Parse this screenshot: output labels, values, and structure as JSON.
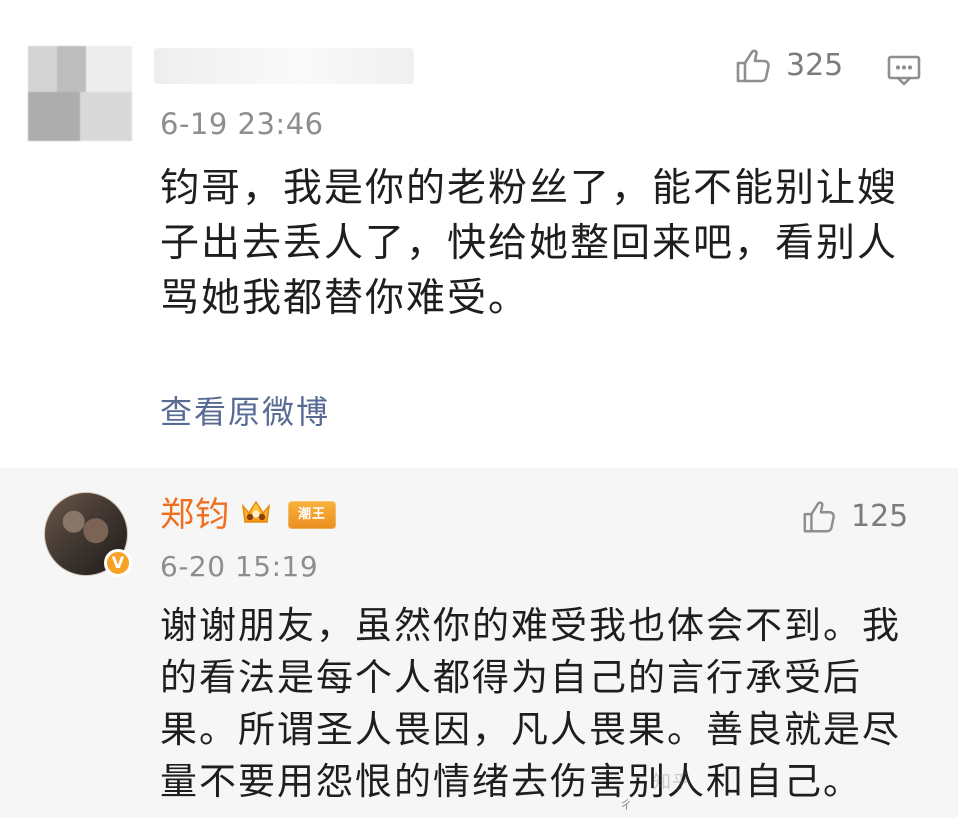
{
  "comment": {
    "like_count": "325",
    "timestamp": "6-19 23:46",
    "text": "钧哥，我是你的老粉丝了，能不能别让嫂子出去丢人了，快给她整回来吧，看别人骂她我都替你难受。",
    "view_original": "查看原微博"
  },
  "reply": {
    "username": "郑钧",
    "level_badge": "潮王",
    "like_count": "125",
    "timestamp": "6-20 15:19",
    "text": "谢谢朋友，虽然你的难受我也体会不到。我的看法是每个人都得为自己的言行承受后果。所谓圣人畏因，凡人畏果。善良就是尽量不要用怨恨的情绪去伤害别人和自己。",
    "verified_label": "V"
  },
  "icons": {
    "like": "thumbs-up-icon",
    "comment": "comment-icon",
    "crown": "crown-icon",
    "verified": "verified-icon"
  },
  "colors": {
    "link": "#576b95",
    "username": "#ef6f1f",
    "badge": "#f7a127",
    "muted": "#8e8e8e",
    "reply_background": "#f6f6f6"
  }
}
